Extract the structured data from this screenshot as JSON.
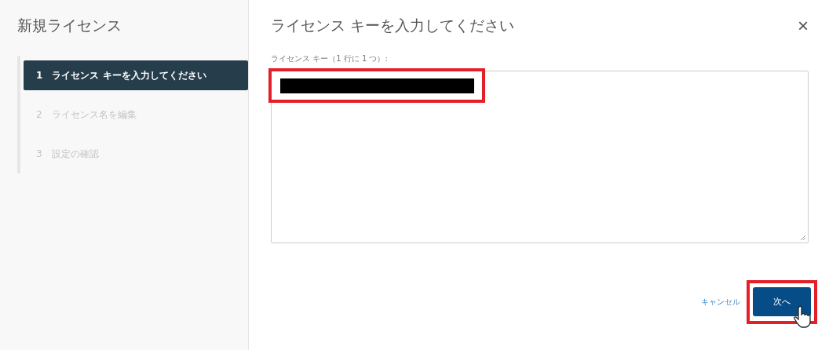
{
  "sidebar": {
    "title": "新規ライセンス",
    "steps": [
      {
        "number": "1",
        "label": "ライセンス キーを入力してください",
        "selected": true
      },
      {
        "number": "2",
        "label": "ライセンス名を編集",
        "selected": false
      },
      {
        "number": "3",
        "label": "設定の確認",
        "selected": false
      }
    ]
  },
  "dialog": {
    "title": "ライセンス キーを入力してください",
    "close": "×",
    "field_label": "ライセンス キー（1 行に 1 つ）:",
    "cancel": "キャンセル",
    "next": "次へ"
  }
}
